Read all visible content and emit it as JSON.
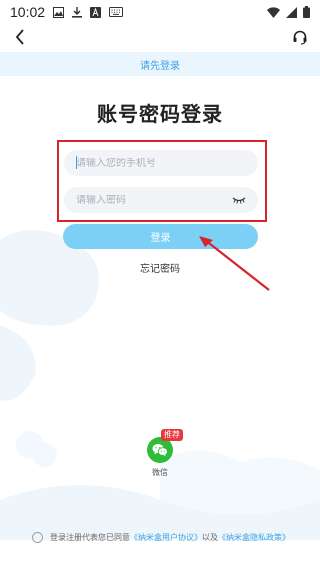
{
  "status_bar": {
    "time": "10:02",
    "left_icons": [
      "image-icon",
      "download-icon",
      "text-icon",
      "keyboard-icon"
    ],
    "right_icons": [
      "wifi-icon",
      "signal-icon",
      "battery-icon"
    ]
  },
  "app_bar": {
    "back_icon": "chevron-left-icon",
    "support_icon": "headset-icon"
  },
  "notice": "请先登录",
  "title": "账号密码登录",
  "form": {
    "phone_placeholder": "请输入您的手机号",
    "password_placeholder": "请输入密码",
    "login_label": "登录",
    "forgot_label": "忘记密码"
  },
  "third_party": {
    "wechat_label": "微信",
    "badge": "推荐"
  },
  "agreement": {
    "prefix": "登录注册代表您已同意",
    "user_agreement": "《纳米盒用户协议》",
    "conjunction": "以及",
    "privacy_policy": "《纳米盒隐私政策》"
  },
  "colors": {
    "accent": "#7dd0f5",
    "notice_bg": "#eaf6fd",
    "link": "#3ea3e3",
    "highlight": "#d9232a",
    "wechat": "#2fbc3a"
  }
}
